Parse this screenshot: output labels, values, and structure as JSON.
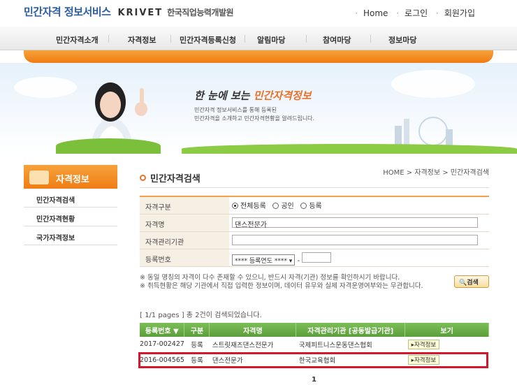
{
  "header": {
    "logo_text": "민간자격 정보서비스",
    "logo_org": "KRIVET",
    "logo_org_name": "한국직업능력개발원",
    "home_link": "Home",
    "login_link": "로그인",
    "join_link": "회원가입"
  },
  "nav": {
    "items": [
      "민간자격소개",
      "자격정보",
      "민간자격등록신청",
      "알림마당",
      "참여마당",
      "정보마당"
    ]
  },
  "banner": {
    "title_prefix": "한 눈에 보는",
    "title_highlight": "민간자격정보",
    "desc_line1": "민간자격 정보서비스를 통해 등록된",
    "desc_line2": "민간자격을 소개하고 민간자격현황을 알려드립니다."
  },
  "sidebar": {
    "header": "자격정보",
    "items": [
      "민간자격검색",
      "민간자격현황",
      "국가자격정보"
    ]
  },
  "content": {
    "title": "민간자격검색",
    "breadcrumb": "HOME > 자격정보 > 민간자격검색"
  },
  "form": {
    "type_label": "자격구분",
    "type_options": [
      "전체등록",
      "공인",
      "등록"
    ],
    "type_selected": "전체등록",
    "name_label": "자격명",
    "name_value": "댄스전문가",
    "org_label": "자격관리기관",
    "org_value": "",
    "regno_label": "등록번호",
    "regno_select": "**** 등록연도 ****",
    "regno_dash": "-",
    "regno_value": ""
  },
  "notes": {
    "line1": "※ 동일 명칭의 자격이 다수 존재할 수 있으니, 반드시 자격(기관) 정보를 확인하시기 바랍니다.",
    "line2": "※ 취득현황은 해당 기관에서 직접 입력한 정보이며, 데이터 유무와 실제 자격운영여부와는 무관합니다."
  },
  "search_button": "검색",
  "results": {
    "summary": "[ 1/1 pages ] 총 2건이 검색되었습니다.",
    "columns": [
      "등록번호 ▼",
      "구분",
      "자격명",
      "자격관리기관 [공동발급기관]",
      "보기"
    ],
    "rows": [
      {
        "regno": "2017-002427",
        "type": "등록",
        "name": "스트릿재즈댄스전문가",
        "org": "국제피트니스운동댄스협회",
        "view": "▸자격정보"
      },
      {
        "regno": "2016-004565",
        "type": "등록",
        "name": "댄스전문가",
        "org": "한국교육협회",
        "view": "▸자격정보"
      }
    ],
    "page": "1"
  },
  "colors": {
    "accent_orange": "#f07b12",
    "table_green": "#5b9e3a",
    "highlight_red": "#d4172a"
  }
}
